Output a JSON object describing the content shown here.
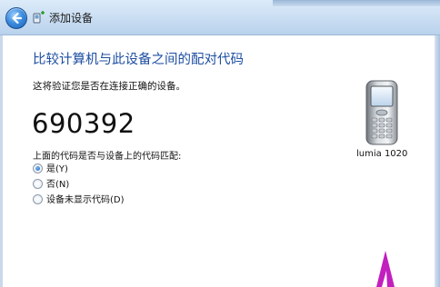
{
  "window": {
    "title": "添加设备"
  },
  "pairing": {
    "heading": "比较计算机与此设备之间的配对代码",
    "subtitle": "这将验证您是否在连接正确的设备。",
    "code": "690392",
    "question": "上面的代码是否与设备上的代码匹配:",
    "options": [
      {
        "label": "是(Y)",
        "selected": true
      },
      {
        "label": "否(N)",
        "selected": false
      },
      {
        "label": "设备未显示代码(D)",
        "selected": false
      }
    ]
  },
  "device": {
    "name": "lumia 1020",
    "icon": "phone-icon"
  },
  "colors": {
    "heading": "#1d4ea1",
    "accent_arrow": "#c21fbf"
  }
}
